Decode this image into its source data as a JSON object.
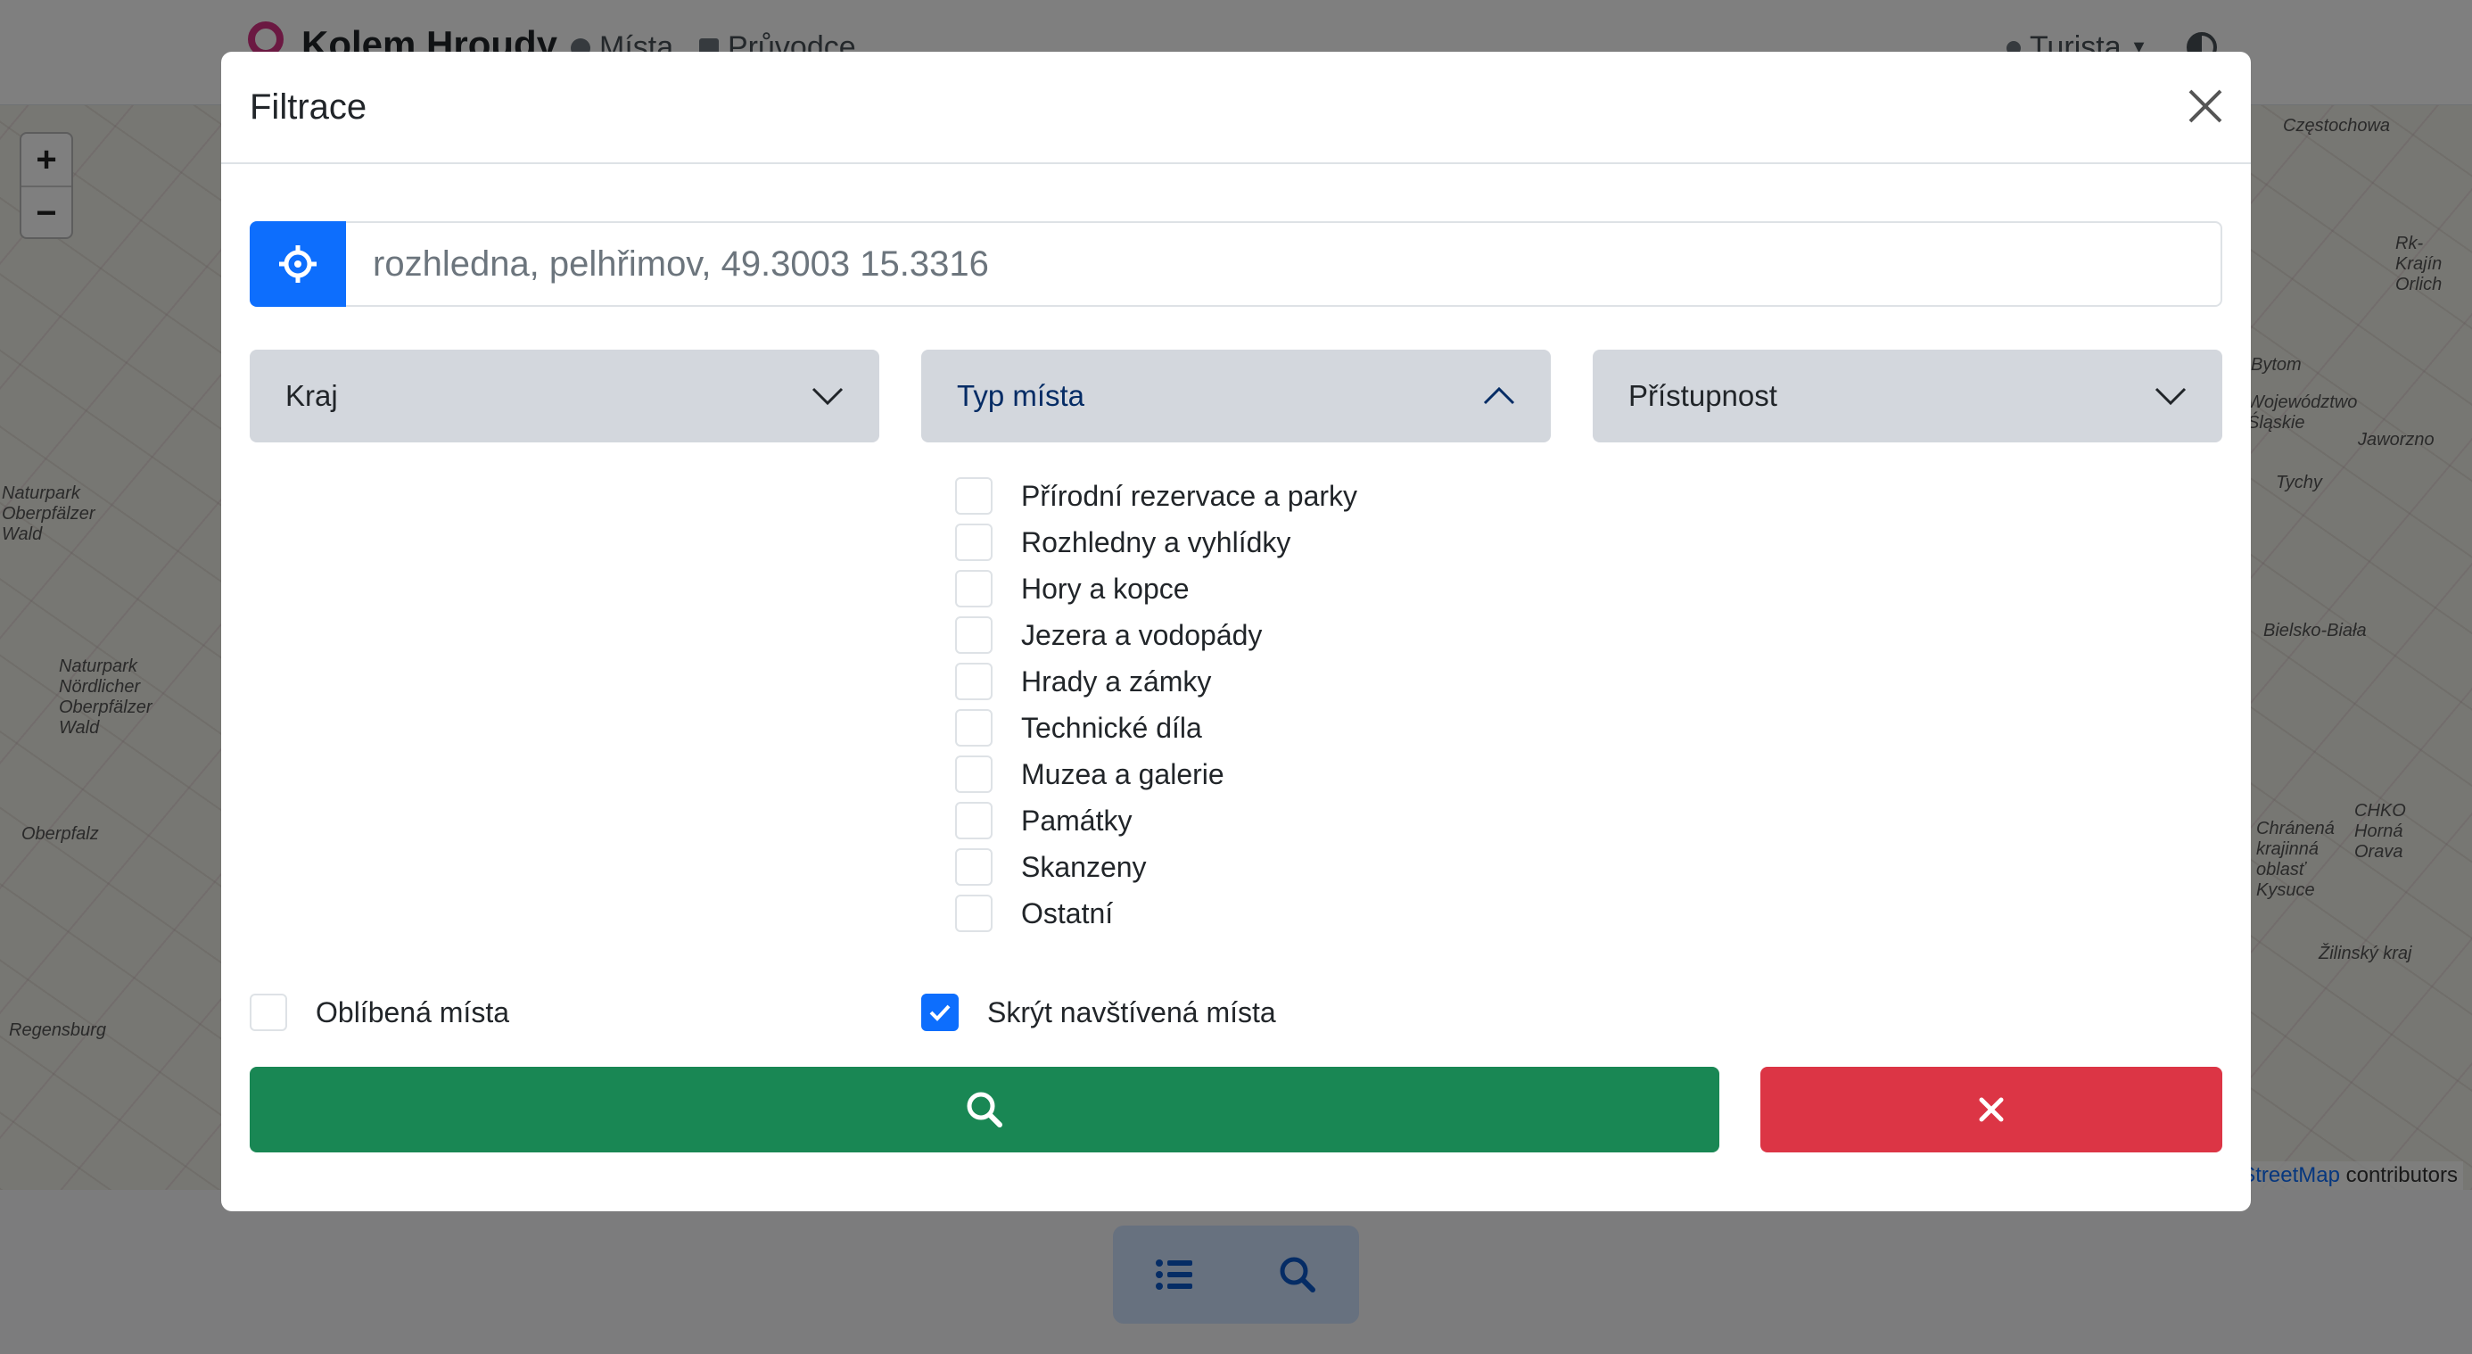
{
  "navbar": {
    "brand": "Kolem Hroudy",
    "links": [
      "Místa",
      "Průvodce"
    ],
    "user": "Turista",
    "icons": {
      "logo": "ring-logo-icon",
      "places": "pin-icon",
      "guide": "book-icon",
      "user": "person-icon",
      "theme": "half-circle-icon"
    }
  },
  "map": {
    "zoom_in": "+",
    "zoom_out": "−",
    "labels": [
      "Częstochowa",
      "Rk-Krajín Orlich",
      "Bytom",
      "Województwo Śląskie",
      "Jaworzno",
      "Tychy",
      "Bielsko-Biała",
      "CHKO Horná Orava",
      "Chránená krajinná oblasť Kysuce",
      "Žilinský kraj",
      "Naturpark Oberpfälzer Wald",
      "Naturpark Nördlicher Oberpfälzer Wald",
      "Oberpfalz",
      "Regensburg"
    ],
    "attribution_link": "StreetMap",
    "attribution_text": " contributors"
  },
  "bottom_bar": {
    "icons": [
      "list-icon",
      "search-icon"
    ]
  },
  "modal": {
    "title": "Filtrace",
    "search": {
      "value": "",
      "placeholder": "rozhledna, pelhřimov, 49.3003 15.3316"
    },
    "accordions": {
      "region": "Kraj",
      "place_type": "Typ místa",
      "accessibility": "Přístupnost"
    },
    "place_types": [
      {
        "label": "Přírodní rezervace a parky",
        "checked": false
      },
      {
        "label": "Rozhledny a vyhlídky",
        "checked": false
      },
      {
        "label": "Hory a kopce",
        "checked": false
      },
      {
        "label": "Jezera a vodopády",
        "checked": false
      },
      {
        "label": "Hrady a zámky",
        "checked": false
      },
      {
        "label": "Technické díla",
        "checked": false
      },
      {
        "label": "Muzea a galerie",
        "checked": false
      },
      {
        "label": "Památky",
        "checked": false
      },
      {
        "label": "Skanzeny",
        "checked": false
      },
      {
        "label": "Ostatní",
        "checked": false
      }
    ],
    "favorites": {
      "label": "Oblíbená místa",
      "checked": false
    },
    "hide_visited": {
      "label": "Skrýt navštívená místa",
      "checked": true
    },
    "colors": {
      "primary": "#0d6efd",
      "success": "#198754",
      "danger": "#dc3545",
      "accordion": "#d3d7dd"
    }
  }
}
